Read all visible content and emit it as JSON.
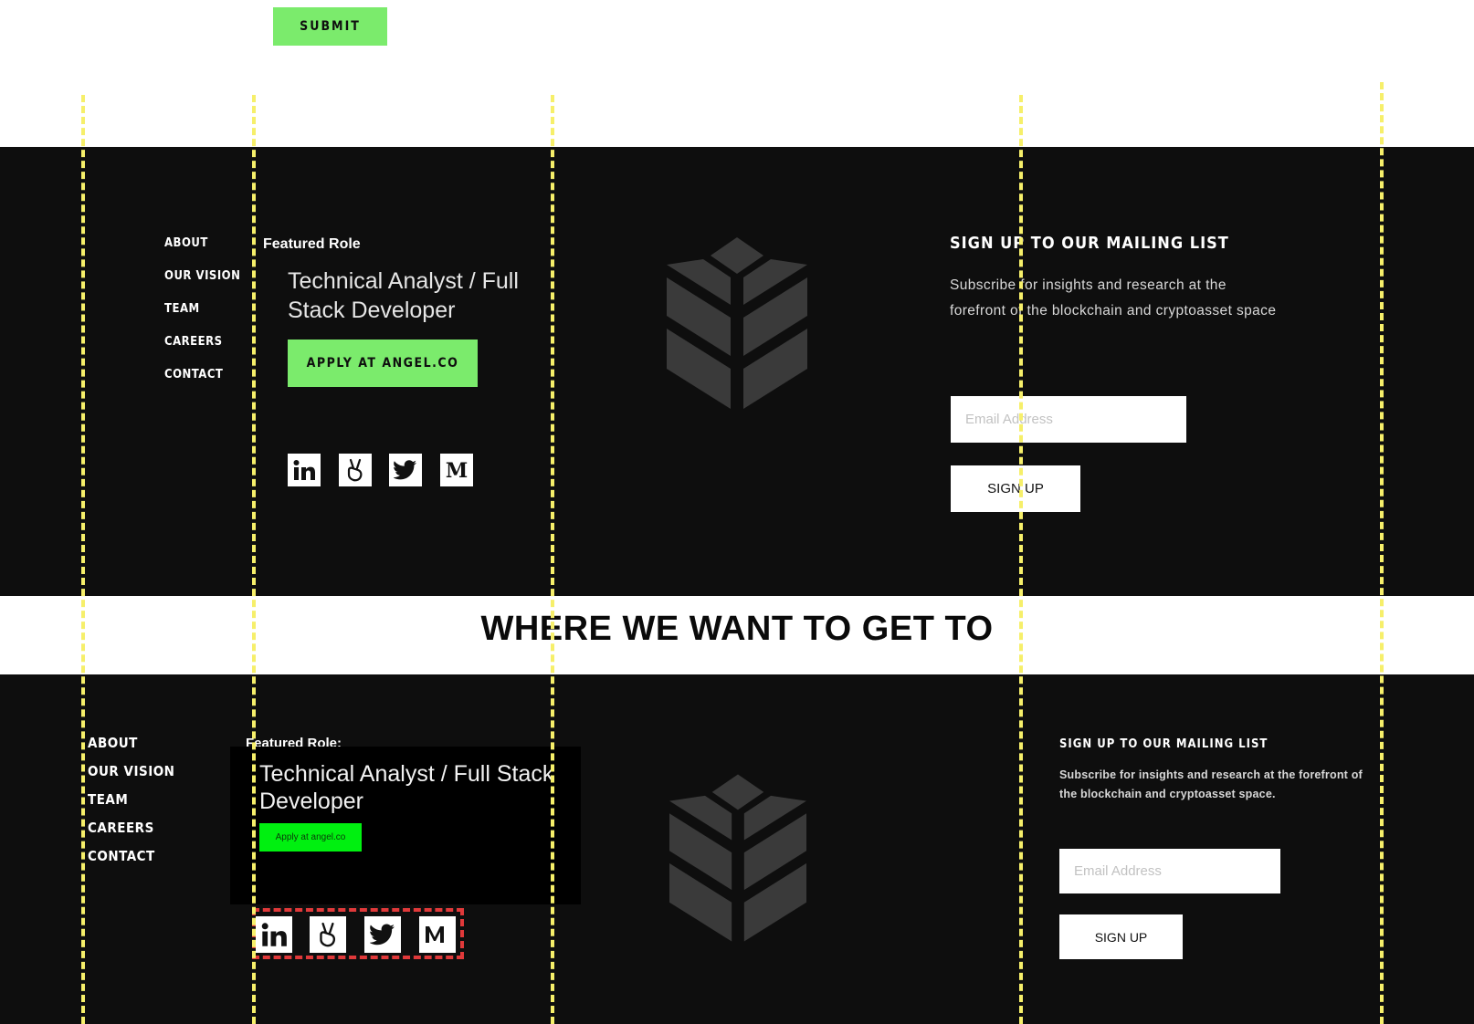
{
  "top_form": {
    "submit_label": "SUBMIT"
  },
  "current_footer": {
    "nav": [
      "ABOUT",
      "OUR VISION",
      "TEAM",
      "CAREERS",
      "CONTACT"
    ],
    "featured_label": "Featured Role",
    "role_title": "Technical Analyst / Full Stack Developer",
    "apply_label": "APPLY AT ANGEL.CO",
    "social": [
      "linkedin-icon",
      "angellist-icon",
      "twitter-icon",
      "medium-icon"
    ],
    "mailing": {
      "heading": "SIGN UP TO OUR MAILING LIST",
      "description": "Subscribe for insights and research at the forefront of the blockchain and cryptoasset space",
      "email_placeholder": "Email Address",
      "signup_label": "SIGN UP"
    }
  },
  "section_heading": "WHERE WE WANT TO GET TO",
  "target_footer": {
    "nav": [
      "ABOUT",
      "OUR VISION",
      "TEAM",
      "CAREERS",
      "CONTACT"
    ],
    "featured_label": "Featured Role:",
    "role_title": "Technical Analyst / Full Stack Developer",
    "apply_label": "Apply at angel.co",
    "social": [
      "linkedin-icon",
      "angellist-icon",
      "twitter-icon",
      "medium-icon"
    ],
    "mailing": {
      "heading": "SIGN UP TO OUR MAILING LIST",
      "description": "Subscribe for insights and research at the forefront of the blockchain and cryptoasset space.",
      "email_placeholder": "Email Address",
      "signup_label": "SIGN UP"
    }
  },
  "colors": {
    "footer_bg": "#0e0e0e",
    "accent_green": "#7beb6c",
    "bright_green": "#00f010",
    "guide_yellow": "#f6ef6a",
    "highlight_red": "#e0393a",
    "logo_gray": "#3a3a3a"
  }
}
